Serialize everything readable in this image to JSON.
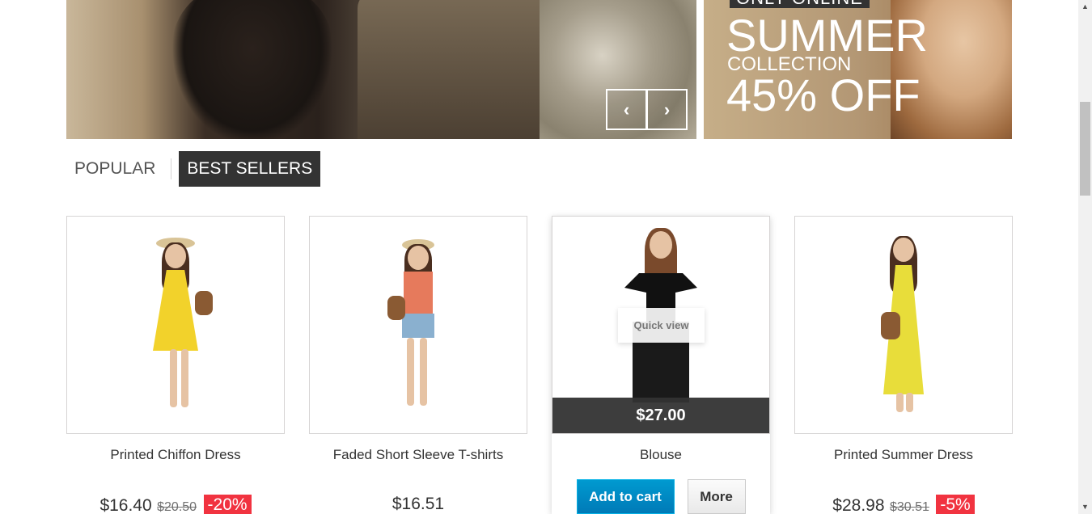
{
  "banner": {
    "slider_prev_icon": "chevron-left-icon",
    "slider_next_icon": "chevron-right-icon",
    "prev_glyph": "‹",
    "next_glyph": "›",
    "side": {
      "only_online": "ONLY ONLINE",
      "summer": "SUMMER",
      "collection": "COLLECTION",
      "off": "45% OFF"
    }
  },
  "tabs": [
    {
      "label": "POPULAR",
      "active": false
    },
    {
      "label": "BEST SELLERS",
      "active": true
    }
  ],
  "products": [
    {
      "name": "Printed Chiffon Dress",
      "price": "$16.40",
      "old_price": "$20.50",
      "discount": "-20%"
    },
    {
      "name": "Faded Short Sleeve T-shirts",
      "price": "$16.51"
    },
    {
      "name": "Blouse",
      "price": "$27.00",
      "quick_view": "Quick view",
      "add_to_cart": "Add to cart",
      "more": "More"
    },
    {
      "name": "Printed Summer Dress",
      "price": "$28.98",
      "old_price": "$30.51",
      "discount": "-5%"
    }
  ],
  "scrollbar": {
    "up_glyph": "▲",
    "down_glyph": "▼"
  },
  "colors": {
    "accent_blue": "#0079b6",
    "sale_red": "#f13340",
    "dark": "#333333"
  }
}
